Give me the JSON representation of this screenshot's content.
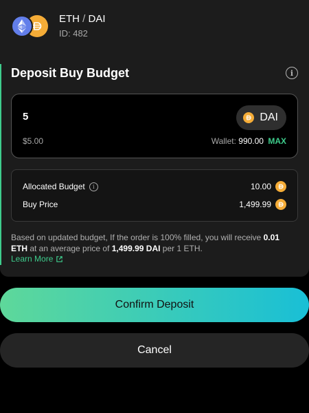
{
  "pair": {
    "base": "ETH",
    "separator": "/",
    "quote": "DAI",
    "id_label": "ID: 482",
    "base_icon": "eth-icon",
    "quote_icon": "dai-icon"
  },
  "section": {
    "title": "Deposit Buy Budget",
    "info_icon": "info-icon",
    "accent_color": "#3ecc8c"
  },
  "budget_input": {
    "value": "5",
    "token_label": "DAI",
    "usd_value": "$5.00",
    "wallet_label": "Wallet:",
    "wallet_balance": "990.00",
    "max_label": "MAX"
  },
  "details": {
    "allocated_label": "Allocated Budget",
    "allocated_value": "10.00",
    "buy_price_label": "Buy Price",
    "buy_price_value": "1,499.99"
  },
  "note": {
    "part1": "Based on updated budget, If the order is 100% filled, you will receive ",
    "eth_amount": "0.01 ETH",
    "part2": " at an average price of ",
    "price": "1,499.99 DAI",
    "part3": " per 1 ETH.",
    "learn_more": "Learn More"
  },
  "actions": {
    "confirm_label": "Confirm Deposit",
    "cancel_label": "Cancel",
    "gradient_start": "#5ed89a",
    "gradient_end": "#19bfd6"
  }
}
